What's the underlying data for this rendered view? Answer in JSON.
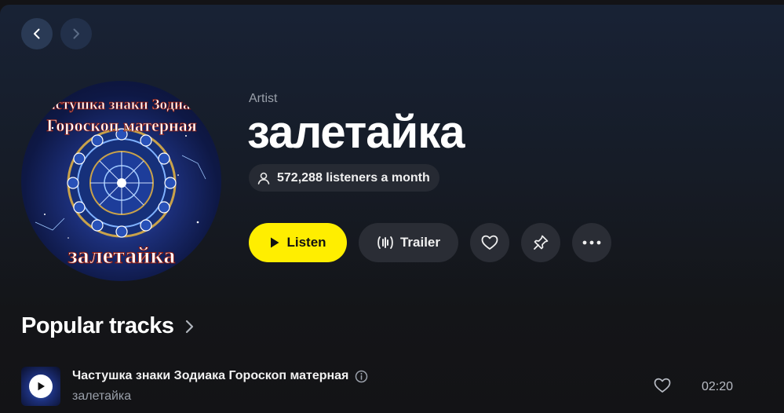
{
  "nav": {
    "back_icon": "chevron-left-icon",
    "forward_icon": "chevron-right-icon"
  },
  "artist": {
    "type_label": "Artist",
    "name": "залетайка",
    "listeners": "572,288 listeners a month",
    "cover_text_top": "Частушка знаки Зодиака",
    "cover_text_mid": "Гороскоп матерная",
    "cover_text_bottom": "залетайка"
  },
  "actions": {
    "listen_label": "Listen",
    "trailer_label": "Trailer"
  },
  "popular": {
    "title": "Popular tracks",
    "tracks": [
      {
        "title": "Частушка знаки Зодиака Гороскоп матерная",
        "artist": "залетайка",
        "duration": "02:20"
      }
    ]
  },
  "colors": {
    "accent": "#ffee00",
    "background": "#131316",
    "chip": "#262a33"
  }
}
